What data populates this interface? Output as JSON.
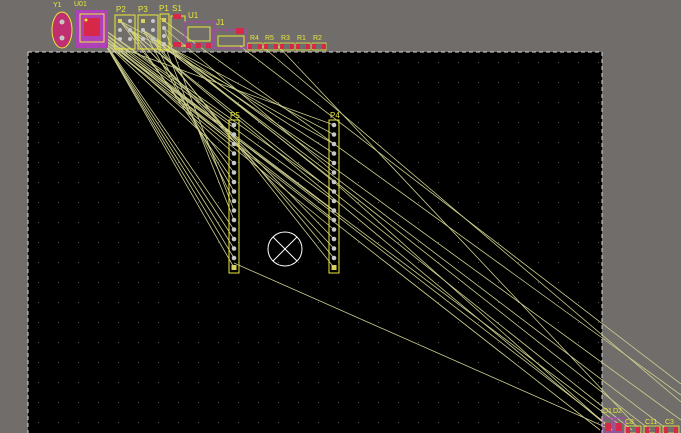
{
  "colors": {
    "background": "#706d6a",
    "board": "#000000",
    "board_edge": "#d8d8d8",
    "grid_dot": "#5a5a5a",
    "ratsnest": "#cfcf8f",
    "silkscreen": "#e8e83a",
    "copper_top": "#d8284a",
    "courtyard": "#b040b8",
    "pad_round": "#c8c8c8",
    "pad_square": "#d8d060",
    "cursor": "#ffffff"
  },
  "components": {
    "Y1": "Y1",
    "U01": "U01",
    "P2": "P2",
    "P3": "P3",
    "P1": "P1",
    "S1": "S1",
    "U1": "U1",
    "J1": "J1",
    "R4": "R4",
    "R5": "R5",
    "R3": "R3",
    "R1": "R1",
    "R2": "R2",
    "P5": "P5",
    "P4": "P4",
    "D1": "D1",
    "D2": "D2",
    "C8": "C8",
    "C11": "C11",
    "C3": "C3"
  },
  "headers": {
    "pin_count": 16
  },
  "cursor_icon": "crosshair-circle-icon"
}
